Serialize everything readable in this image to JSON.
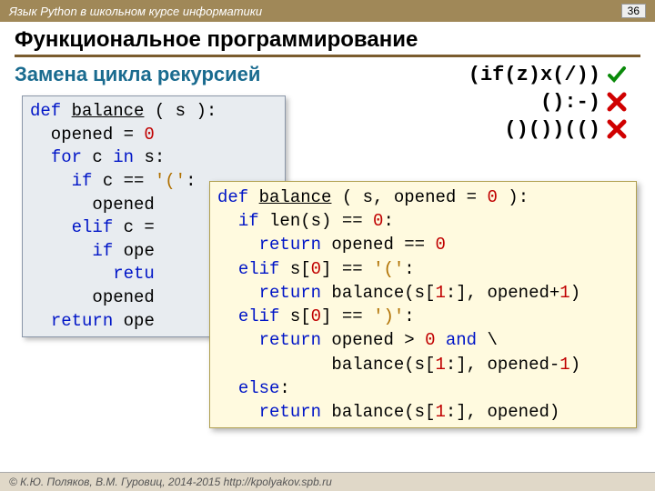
{
  "header": {
    "course": "Язык Python в школьном курсе информатики",
    "page": "36"
  },
  "title": "Функциональное программирование",
  "subtitle": "Замена цикла рекурсией",
  "examples": {
    "e1": "(if(z)x(/))",
    "e2": "():-)",
    "e3": "()())(()"
  },
  "code1": {
    "l1a": "def",
    "l1b": "balance",
    "l1c": " ( s ):",
    "l2a": "  opened = ",
    "l2b": "0",
    "l3a": "  ",
    "l3b": "for",
    "l3c": " c ",
    "l3d": "in",
    "l3e": " s:",
    "l4a": "    ",
    "l4b": "if",
    "l4c": " c == ",
    "l4d": "'('",
    "l4e": ":",
    "l5a": "      opened",
    "l6a": "    ",
    "l6b": "elif",
    "l6c": " c =",
    "l7a": "      ",
    "l7b": "if",
    "l7c": " ope",
    "l8a": "        ",
    "l8b": "retu",
    "l9a": "      opened",
    "l10a": "  ",
    "l10b": "return",
    "l10c": " ope"
  },
  "code2": {
    "l1a": "def",
    "l1b": "balance",
    "l1c": " ( s, opened = ",
    "l1d": "0",
    "l1e": " ):",
    "l2a": "  ",
    "l2b": "if",
    "l2c": " len(s) == ",
    "l2d": "0",
    "l2e": ":",
    "l3a": "    ",
    "l3b": "return",
    "l3c": " opened == ",
    "l3d": "0",
    "l4a": "  ",
    "l4b": "elif",
    "l4c": " s[",
    "l4d": "0",
    "l4e": "] == ",
    "l4f": "'('",
    "l4g": ":",
    "l5a": "    ",
    "l5b": "return",
    "l5c": " balance(s[",
    "l5d": "1",
    "l5e": ":], opened+",
    "l5f": "1",
    "l5g": ")",
    "l6a": "  ",
    "l6b": "elif",
    "l6c": " s[",
    "l6d": "0",
    "l6e": "] == ",
    "l6f": "')'",
    "l6g": ":",
    "l7a": "    ",
    "l7b": "return",
    "l7c": " opened > ",
    "l7d": "0",
    "l7e": " ",
    "l7f": "and",
    "l7g": " \\",
    "l8a": "           balance(s[",
    "l8b": "1",
    "l8c": ":], opened-",
    "l8d": "1",
    "l8e": ")",
    "l9a": "  ",
    "l9b": "else",
    "l9c": ":",
    "l10a": "    ",
    "l10b": "return",
    "l10c": " balance(s[",
    "l10d": "1",
    "l10e": ":], opened)"
  },
  "footer": "© К.Ю. Поляков, В.М. Гуровиц, 2014-2015    http://kpolyakov.spb.ru"
}
